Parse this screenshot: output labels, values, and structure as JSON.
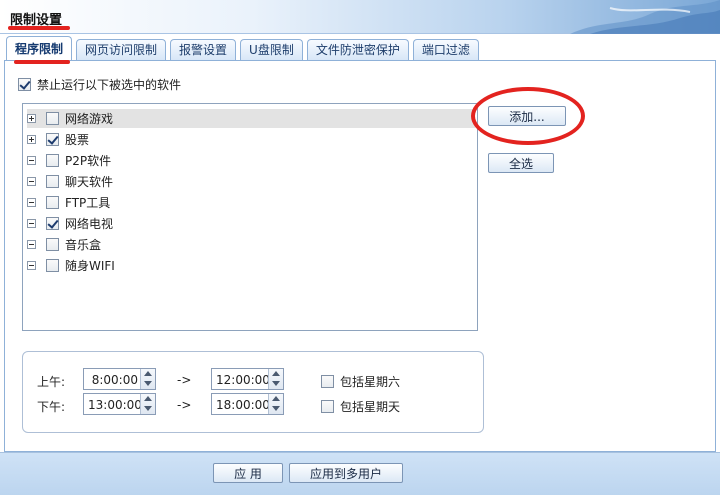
{
  "window": {
    "title": "限制设置"
  },
  "tabs": [
    {
      "label": "程序限制",
      "active": true
    },
    {
      "label": "网页访问限制",
      "active": false
    },
    {
      "label": "报警设置",
      "active": false
    },
    {
      "label": "U盘限制",
      "active": false
    },
    {
      "label": "文件防泄密保护",
      "active": false
    },
    {
      "label": "端口过滤",
      "active": false
    }
  ],
  "program": {
    "forbid_label": "禁止运行以下被选中的软件",
    "forbid_checked": true,
    "items": [
      {
        "label": "网络游戏",
        "expander": "plus",
        "checked": false,
        "highlighted": true
      },
      {
        "label": "股票",
        "expander": "plus",
        "checked": true,
        "highlighted": false
      },
      {
        "label": "P2P软件",
        "expander": "minus",
        "checked": false,
        "highlighted": false
      },
      {
        "label": "聊天软件",
        "expander": "minus",
        "checked": false,
        "highlighted": false
      },
      {
        "label": "FTP工具",
        "expander": "minus",
        "checked": false,
        "highlighted": false
      },
      {
        "label": "网络电视",
        "expander": "minus",
        "checked": true,
        "highlighted": false
      },
      {
        "label": "音乐盒",
        "expander": "minus",
        "checked": false,
        "highlighted": false
      },
      {
        "label": "随身WIFI",
        "expander": "minus",
        "checked": false,
        "highlighted": false
      }
    ],
    "add_button": "添加...",
    "select_all_button": "全选"
  },
  "schedule": {
    "am_label": "上午:",
    "pm_label": "下午:",
    "am_start": "8:00:00",
    "am_end": "12:00:00",
    "pm_start": "13:00:00",
    "pm_end": "18:00:00",
    "arrow": "->",
    "include_sat": {
      "label": "包括星期六",
      "checked": false
    },
    "include_sun": {
      "label": "包括星期天",
      "checked": false
    }
  },
  "footer": {
    "apply_button": "应 用",
    "apply_multi_button": "应用到多用户"
  },
  "colors": {
    "annotation_red": "#e3231f",
    "tab_border": "#8fb1d8",
    "footer_bg": "#c5dbf2"
  }
}
